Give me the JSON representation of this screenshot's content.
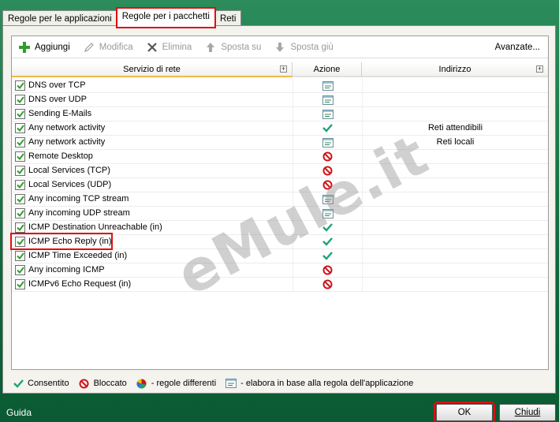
{
  "tabs": [
    {
      "label": "Regole per le applicazioni",
      "active": false
    },
    {
      "label": "Regole per i pacchetti",
      "active": true
    },
    {
      "label": "Reti",
      "active": false
    }
  ],
  "toolbar": {
    "add": "Aggiungi",
    "edit": "Modifica",
    "delete": "Elimina",
    "move_up": "Sposta su",
    "move_down": "Sposta giù",
    "advanced": "Avanzate..."
  },
  "columns": {
    "service": "Servizio di rete",
    "action": "Azione",
    "address": "Indirizzo"
  },
  "rows": [
    {
      "name": "DNS over TCP",
      "action": "app-rule",
      "address": ""
    },
    {
      "name": "DNS over UDP",
      "action": "app-rule",
      "address": ""
    },
    {
      "name": "Sending E-Mails",
      "action": "app-rule",
      "address": ""
    },
    {
      "name": "Any network activity",
      "action": "allowed",
      "address": "Reti attendibili"
    },
    {
      "name": "Any network activity",
      "action": "app-rule",
      "address": "Reti locali"
    },
    {
      "name": "Remote Desktop",
      "action": "blocked",
      "address": ""
    },
    {
      "name": "Local Services (TCP)",
      "action": "blocked",
      "address": ""
    },
    {
      "name": "Local Services (UDP)",
      "action": "blocked",
      "address": ""
    },
    {
      "name": "Any incoming TCP stream",
      "action": "app-rule",
      "address": ""
    },
    {
      "name": "Any incoming UDP stream",
      "action": "app-rule",
      "address": ""
    },
    {
      "name": "ICMP Destination Unreachable (in)",
      "action": "allowed",
      "address": ""
    },
    {
      "name": "ICMP Echo Reply (in)",
      "action": "allowed",
      "address": ""
    },
    {
      "name": "ICMP Time Exceeded (in)",
      "action": "allowed",
      "address": ""
    },
    {
      "name": "Any incoming ICMP",
      "action": "blocked",
      "address": ""
    },
    {
      "name": "ICMPv6 Echo Request (in)",
      "action": "blocked",
      "address": ""
    }
  ],
  "legend": {
    "allowed": "Consentito",
    "blocked": "Bloccato",
    "mixed": "- regole differenti",
    "app_rule": "- elabora in base alla regola dell'applicazione"
  },
  "footer": {
    "help": "Guida",
    "ok": "OK",
    "cancel": "Chiudi"
  },
  "watermark": "eMule.it",
  "colors": {
    "allowed": "#1aa37a",
    "blocked": "#d0141a",
    "highlight": "#e01010",
    "frame": "#1f7a4c"
  }
}
